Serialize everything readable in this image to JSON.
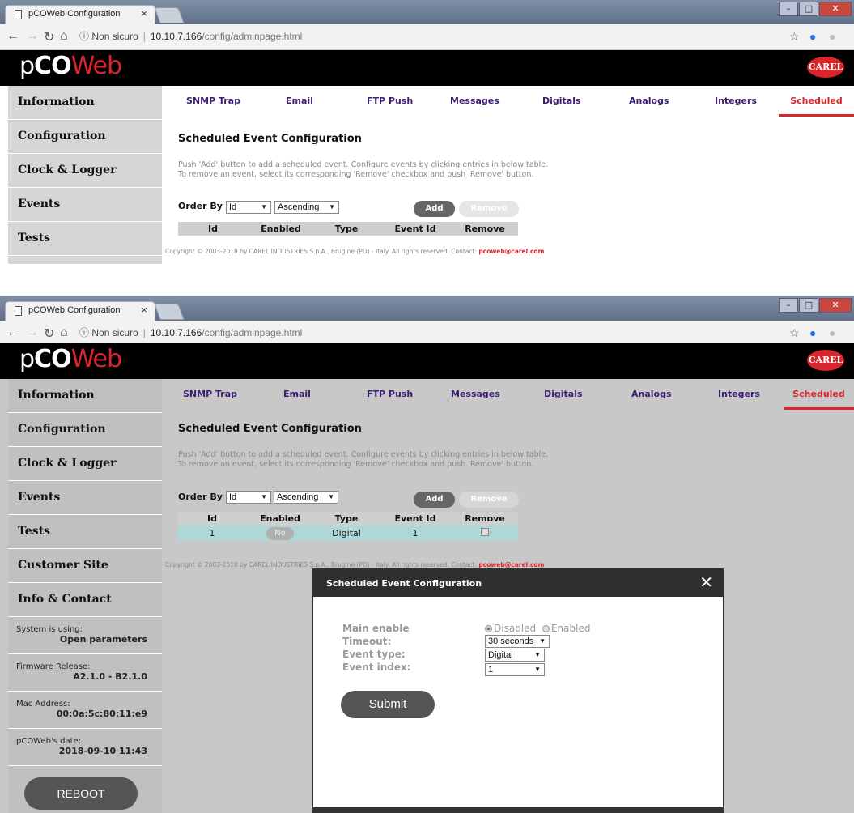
{
  "browser": {
    "tab_title": "pCOWeb Configuration",
    "tab_close": "×",
    "security": "Non sicuro",
    "host": "10.10.7.166",
    "path": "/config/adminpage.html"
  },
  "brand": {
    "logo_p": "p",
    "logo_co": "CO",
    "logo_w": "W",
    "logo_eb": "eb",
    "carel": "CAREL"
  },
  "sidebar": {
    "items": [
      "Information",
      "Configuration",
      "Clock & Logger",
      "Events",
      "Tests",
      "Customer Site",
      "Info & Contact"
    ],
    "system_label": "System is using:",
    "system_value": "Open parameters",
    "firmware_label": "Firmware Release:",
    "firmware_value": "A2.1.0 - B2.1.0",
    "mac_label": "Mac Address:",
    "mac_value": "00:0a:5c:80:11:e9",
    "date_label": "pCOWeb's date:",
    "date_value": "2018-09-10 11:43",
    "reboot": "REBOOT"
  },
  "tabs": [
    "SNMP Trap",
    "Email",
    "FTP Push",
    "Messages",
    "Digitals",
    "Analogs",
    "Integers",
    "Scheduled"
  ],
  "main": {
    "heading": "Scheduled Event Configuration",
    "desc1": "Push 'Add' button to add a scheduled event. Configure events by clicking entries in below table.",
    "desc2": "To remove an event, select its corresponding 'Remove' checkbox and push 'Remove' button.",
    "order_by": "Order By",
    "order_field": "Id",
    "order_dir": "Ascending",
    "add": "Add",
    "remove": "Remove",
    "columns": [
      "Id",
      "Enabled",
      "Type",
      "Event Id",
      "Remove"
    ],
    "row": {
      "id": "1",
      "enabled": "No",
      "type": "Digital",
      "event_id": "1"
    },
    "copyright": "Copyright © 2003-2018 by CAREL INDUSTRIES S.p.A., Brugine (PD) - Italy. All rights reserved. Contact: ",
    "email": "pcoweb@carel.com"
  },
  "modal": {
    "title": "Scheduled Event Configuration",
    "close": "✕",
    "main_enable": "Main enable",
    "disabled": "Disabled",
    "enabled": "Enabled",
    "timeout": "Timeout:",
    "timeout_value": "30 seconds",
    "event_type": "Event type:",
    "event_type_value": "Digital",
    "event_index": "Event index:",
    "event_index_value": "1",
    "submit": "Submit"
  }
}
